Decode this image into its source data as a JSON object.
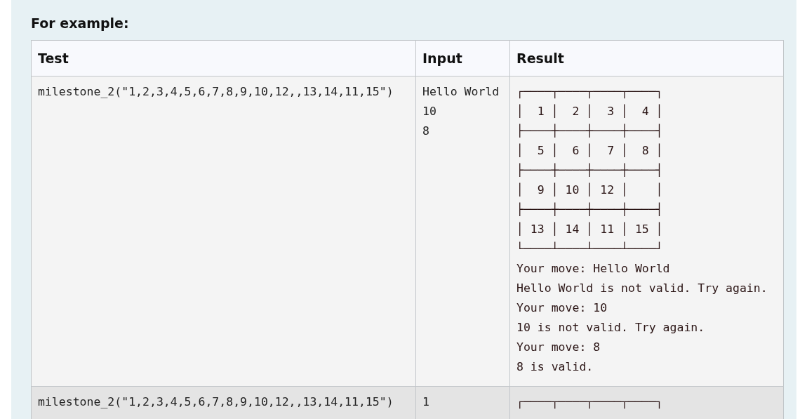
{
  "heading": "For example:",
  "columns": [
    "Test",
    "Input",
    "Result"
  ],
  "rows": [
    {
      "test": "milestone_2(\"1,2,3,4,5,6,7,8,9,10,12,,13,14,11,15\")",
      "input": [
        "Hello World",
        "10",
        "8"
      ],
      "result": [
        "┌────┬────┬────┬────┐",
        "│  1 │  2 │  3 │  4 │",
        "├────┼────┼────┼────┤",
        "│  5 │  6 │  7 │  8 │",
        "├────┼────┼────┼────┤",
        "│  9 │ 10 │ 12 │    │",
        "├────┼────┼────┼────┤",
        "│ 13 │ 14 │ 11 │ 15 │",
        "└────┴────┴────┴────┘",
        "Your move: Hello World",
        "Hello World is not valid. Try again.",
        "Your move: 10",
        "10 is not valid. Try again.",
        "Your move: 8",
        "8 is valid."
      ]
    },
    {
      "test": "milestone_2(\"1,2,3,4,5,6,7,8,9,10,12,,13,14,11,15\")",
      "input": [
        "1"
      ],
      "result": [
        "┌────┬────┬────┬────┐"
      ]
    }
  ]
}
